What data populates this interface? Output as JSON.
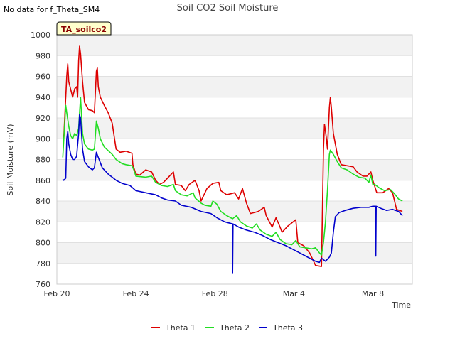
{
  "note": "No data for f_Theta_SM4",
  "badge": "TA_soilco2",
  "chart_data": {
    "type": "line",
    "title": "Soil CO2 Soil Moisture",
    "xlabel": "Time",
    "ylabel": "Soil Moisture (mV)",
    "ylim": [
      760,
      1000
    ],
    "yticks": [
      760,
      780,
      800,
      820,
      840,
      860,
      880,
      900,
      920,
      940,
      960,
      980,
      1000
    ],
    "xlim_days": [
      0,
      18
    ],
    "xticks": [
      {
        "label": "Feb 20",
        "day": 0
      },
      {
        "label": "Feb 24",
        "day": 4
      },
      {
        "label": "Feb 28",
        "day": 8
      },
      {
        "label": "Mar 4",
        "day": 12
      },
      {
        "label": "Mar 8",
        "day": 16
      }
    ],
    "grid": true,
    "legend_position": "bottom",
    "series": [
      {
        "name": "Theta 1",
        "color": "#dd0000",
        "points": [
          [
            0.3,
            903
          ],
          [
            0.35,
            901
          ],
          [
            0.5,
            960
          ],
          [
            0.55,
            972
          ],
          [
            0.6,
            955
          ],
          [
            0.8,
            940
          ],
          [
            0.9,
            948
          ],
          [
            1.0,
            950
          ],
          [
            1.05,
            940
          ],
          [
            1.1,
            975
          ],
          [
            1.15,
            989
          ],
          [
            1.2,
            982
          ],
          [
            1.3,
            955
          ],
          [
            1.4,
            935
          ],
          [
            1.6,
            928
          ],
          [
            1.8,
            927
          ],
          [
            1.9,
            925
          ],
          [
            2.0,
            965
          ],
          [
            2.05,
            968
          ],
          [
            2.1,
            950
          ],
          [
            2.2,
            940
          ],
          [
            2.4,
            932
          ],
          [
            2.6,
            925
          ],
          [
            2.8,
            915
          ],
          [
            3.0,
            890
          ],
          [
            3.2,
            887
          ],
          [
            3.5,
            888
          ],
          [
            3.8,
            886
          ],
          [
            3.85,
            875
          ],
          [
            4.0,
            866
          ],
          [
            4.2,
            865
          ],
          [
            4.5,
            870
          ],
          [
            4.8,
            868
          ],
          [
            5.0,
            860
          ],
          [
            5.2,
            856
          ],
          [
            5.4,
            858
          ],
          [
            5.6,
            862
          ],
          [
            5.9,
            868
          ],
          [
            6.0,
            856
          ],
          [
            6.3,
            855
          ],
          [
            6.5,
            850
          ],
          [
            6.7,
            856
          ],
          [
            7.0,
            860
          ],
          [
            7.2,
            850
          ],
          [
            7.3,
            840
          ],
          [
            7.6,
            852
          ],
          [
            7.9,
            857
          ],
          [
            8.2,
            858
          ],
          [
            8.3,
            850
          ],
          [
            8.6,
            846
          ],
          [
            9.0,
            848
          ],
          [
            9.2,
            842
          ],
          [
            9.4,
            852
          ],
          [
            9.6,
            838
          ],
          [
            9.8,
            828
          ],
          [
            10.2,
            830
          ],
          [
            10.5,
            834
          ],
          [
            10.6,
            826
          ],
          [
            10.9,
            815
          ],
          [
            11.1,
            824
          ],
          [
            11.3,
            815
          ],
          [
            11.4,
            810
          ],
          [
            11.7,
            816
          ],
          [
            12.1,
            822
          ],
          [
            12.2,
            800
          ],
          [
            12.5,
            797
          ],
          [
            12.8,
            790
          ],
          [
            13.1,
            778
          ],
          [
            13.4,
            777
          ],
          [
            13.5,
            890
          ],
          [
            13.55,
            914
          ],
          [
            13.65,
            900
          ],
          [
            13.7,
            890
          ],
          [
            13.8,
            930
          ],
          [
            13.85,
            940
          ],
          [
            13.9,
            930
          ],
          [
            14.0,
            905
          ],
          [
            14.2,
            885
          ],
          [
            14.4,
            875
          ],
          [
            14.7,
            874
          ],
          [
            15.0,
            873
          ],
          [
            15.2,
            868
          ],
          [
            15.5,
            864
          ],
          [
            15.7,
            864
          ],
          [
            15.9,
            868
          ],
          [
            16.0,
            860
          ],
          [
            16.2,
            848
          ],
          [
            16.5,
            848
          ],
          [
            16.8,
            852
          ],
          [
            17.0,
            848
          ],
          [
            17.2,
            832
          ],
          [
            17.5,
            830
          ]
        ]
      },
      {
        "name": "Theta 2",
        "color": "#22dd22",
        "points": [
          [
            0.3,
            882
          ],
          [
            0.45,
            932
          ],
          [
            0.5,
            925
          ],
          [
            0.6,
            912
          ],
          [
            0.7,
            903
          ],
          [
            0.8,
            900
          ],
          [
            0.9,
            905
          ],
          [
            1.0,
            903
          ],
          [
            1.1,
            910
          ],
          [
            1.2,
            940
          ],
          [
            1.3,
            905
          ],
          [
            1.4,
            895
          ],
          [
            1.6,
            890
          ],
          [
            1.8,
            889
          ],
          [
            1.9,
            890
          ],
          [
            2.0,
            917
          ],
          [
            2.1,
            910
          ],
          [
            2.2,
            900
          ],
          [
            2.4,
            892
          ],
          [
            2.8,
            885
          ],
          [
            3.0,
            880
          ],
          [
            3.3,
            876
          ],
          [
            3.5,
            875
          ],
          [
            3.8,
            874
          ],
          [
            3.9,
            870
          ],
          [
            4.0,
            864
          ],
          [
            4.5,
            863
          ],
          [
            4.8,
            864
          ],
          [
            5.0,
            858
          ],
          [
            5.3,
            855
          ],
          [
            5.6,
            854
          ],
          [
            5.9,
            856
          ],
          [
            6.0,
            850
          ],
          [
            6.3,
            846
          ],
          [
            6.6,
            845
          ],
          [
            6.9,
            848
          ],
          [
            7.0,
            843
          ],
          [
            7.3,
            838
          ],
          [
            7.5,
            836
          ],
          [
            7.8,
            835
          ],
          [
            7.9,
            840
          ],
          [
            8.1,
            837
          ],
          [
            8.3,
            830
          ],
          [
            8.6,
            826
          ],
          [
            8.9,
            823
          ],
          [
            9.1,
            826
          ],
          [
            9.3,
            820
          ],
          [
            9.6,
            816
          ],
          [
            9.9,
            814
          ],
          [
            10.1,
            818
          ],
          [
            10.3,
            812
          ],
          [
            10.6,
            808
          ],
          [
            10.9,
            806
          ],
          [
            11.1,
            810
          ],
          [
            11.3,
            803
          ],
          [
            11.6,
            799
          ],
          [
            11.9,
            798
          ],
          [
            12.1,
            802
          ],
          [
            12.3,
            796
          ],
          [
            12.6,
            795
          ],
          [
            12.9,
            794
          ],
          [
            13.1,
            795
          ],
          [
            13.3,
            790
          ],
          [
            13.4,
            788
          ],
          [
            13.5,
            800
          ],
          [
            13.6,
            820
          ],
          [
            13.7,
            850
          ],
          [
            13.8,
            885
          ],
          [
            13.85,
            889
          ],
          [
            14.0,
            885
          ],
          [
            14.2,
            878
          ],
          [
            14.4,
            872
          ],
          [
            14.7,
            870
          ],
          [
            15.0,
            866
          ],
          [
            15.3,
            863
          ],
          [
            15.6,
            862
          ],
          [
            15.8,
            858
          ],
          [
            15.9,
            865
          ],
          [
            16.0,
            856
          ],
          [
            16.1,
            856
          ],
          [
            16.3,
            853
          ],
          [
            16.6,
            850
          ],
          [
            16.9,
            851
          ],
          [
            17.1,
            847
          ],
          [
            17.3,
            842
          ],
          [
            17.5,
            840
          ]
        ]
      },
      {
        "name": "Theta 3",
        "color": "#0000cc",
        "points": [
          [
            0.3,
            861
          ],
          [
            0.35,
            860
          ],
          [
            0.45,
            862
          ],
          [
            0.5,
            900
          ],
          [
            0.55,
            907
          ],
          [
            0.6,
            895
          ],
          [
            0.7,
            885
          ],
          [
            0.8,
            880
          ],
          [
            0.9,
            880
          ],
          [
            1.0,
            883
          ],
          [
            1.1,
            905
          ],
          [
            1.15,
            923
          ],
          [
            1.2,
            920
          ],
          [
            1.3,
            890
          ],
          [
            1.4,
            878
          ],
          [
            1.6,
            873
          ],
          [
            1.8,
            870
          ],
          [
            1.9,
            872
          ],
          [
            2.0,
            887
          ],
          [
            2.1,
            882
          ],
          [
            2.3,
            872
          ],
          [
            2.6,
            866
          ],
          [
            3.0,
            860
          ],
          [
            3.3,
            857
          ],
          [
            3.7,
            855
          ],
          [
            4.0,
            850
          ],
          [
            4.5,
            848
          ],
          [
            5.0,
            846
          ],
          [
            5.3,
            843
          ],
          [
            5.6,
            841
          ],
          [
            6.0,
            840
          ],
          [
            6.3,
            836
          ],
          [
            6.8,
            834
          ],
          [
            7.3,
            830
          ],
          [
            7.8,
            828
          ],
          [
            8.1,
            824
          ],
          [
            8.5,
            820
          ],
          [
            8.9,
            818
          ],
          [
            8.9,
            771
          ],
          [
            8.92,
            818
          ],
          [
            9.2,
            815
          ],
          [
            9.6,
            812
          ],
          [
            10.0,
            810
          ],
          [
            10.4,
            807
          ],
          [
            10.8,
            803
          ],
          [
            11.2,
            800
          ],
          [
            11.6,
            797
          ],
          [
            12.0,
            793
          ],
          [
            12.3,
            790
          ],
          [
            12.6,
            787
          ],
          [
            12.9,
            784
          ],
          [
            13.1,
            782
          ],
          [
            13.3,
            781
          ],
          [
            13.4,
            785
          ],
          [
            13.6,
            782
          ],
          [
            13.8,
            786
          ],
          [
            13.9,
            790
          ],
          [
            14.0,
            810
          ],
          [
            14.1,
            825
          ],
          [
            14.3,
            829
          ],
          [
            14.6,
            831
          ],
          [
            15.0,
            833
          ],
          [
            15.4,
            834
          ],
          [
            15.8,
            834
          ],
          [
            16.0,
            835
          ],
          [
            16.15,
            835
          ],
          [
            16.15,
            787
          ],
          [
            16.17,
            835
          ],
          [
            16.4,
            833
          ],
          [
            16.7,
            831
          ],
          [
            17.0,
            832
          ],
          [
            17.3,
            830
          ],
          [
            17.5,
            826
          ]
        ]
      }
    ]
  }
}
